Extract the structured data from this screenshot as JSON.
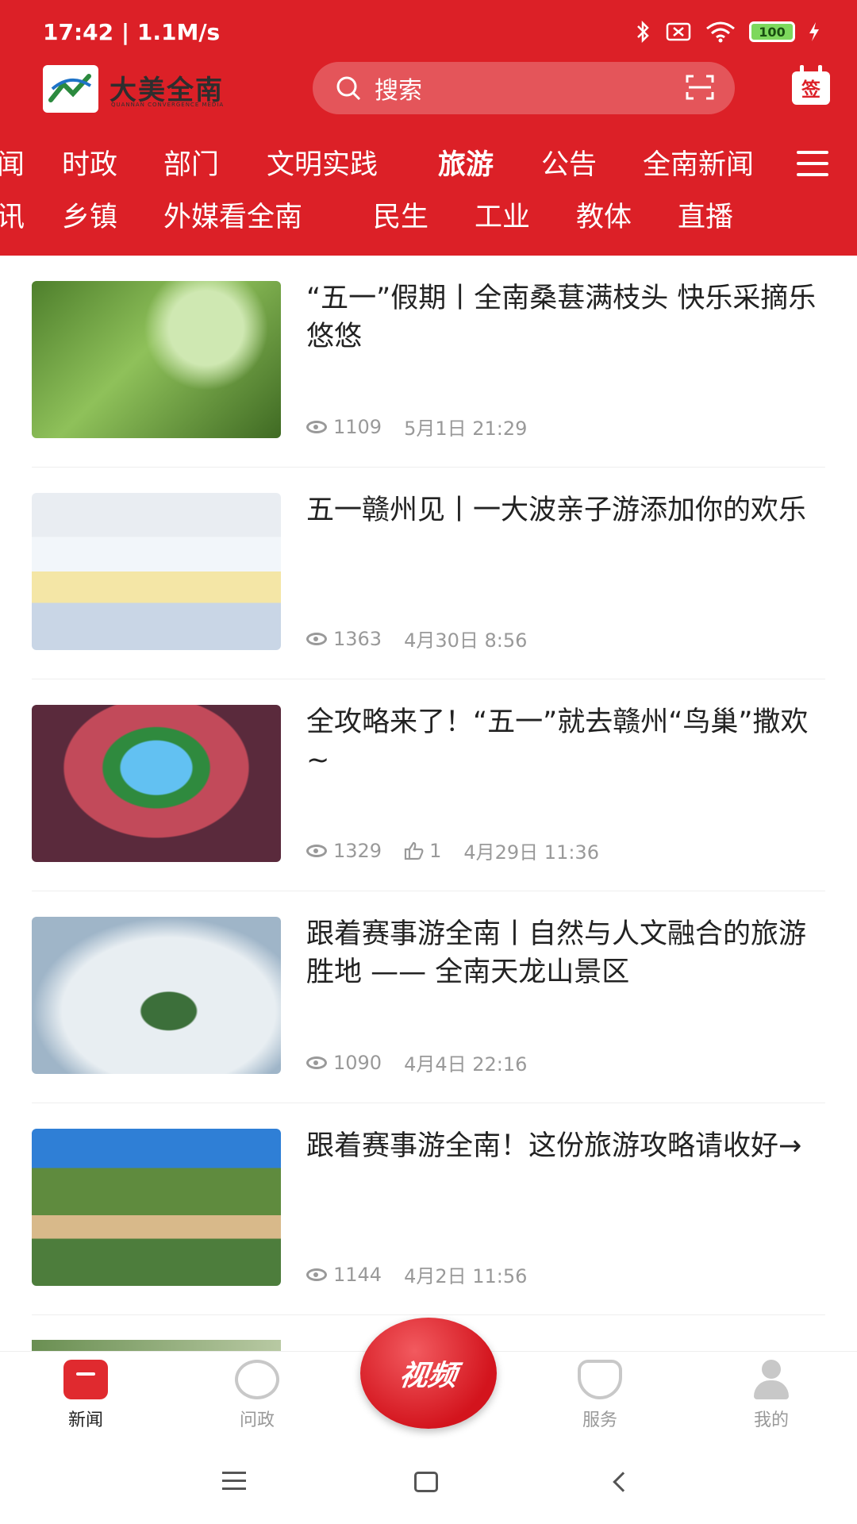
{
  "status_bar": {
    "time_speed": "17:42 | 1.1M/s",
    "battery": "100",
    "icons": [
      "bluetooth-icon",
      "sim-off-icon",
      "wifi-icon",
      "battery-icon",
      "charging-icon"
    ]
  },
  "app": {
    "logo_title": "大美全南",
    "logo_subtitle": "QUANNAN CONVERGENCE MEDIA",
    "search_placeholder": "搜索",
    "sign_label": "签"
  },
  "channels": {
    "row1": [
      "闻",
      "时政",
      "部门",
      "文明实践",
      "旅游",
      "公告",
      "全南新闻"
    ],
    "row2": [
      "讯",
      "乡镇",
      "外媒看全南",
      "民生",
      "工业",
      "教体",
      "直播"
    ],
    "active": "旅游"
  },
  "news": [
    {
      "title": "“五一”假期丨全南桑葚满枝头 快乐采摘乐悠悠",
      "views": "1109",
      "likes": "",
      "date": "5月1日 21:29"
    },
    {
      "title": "五一赣州见丨一大波亲子游添加你的欢乐",
      "views": "1363",
      "likes": "",
      "date": "4月30日 8:56"
    },
    {
      "title": "全攻略来了！“五一”就去赣州“鸟巢”撒欢~",
      "views": "1329",
      "likes": "1",
      "date": "4月29日 11:36"
    },
    {
      "title": "跟着赛事游全南丨自然与人文融合的旅游胜地 —— 全南天龙山景区",
      "views": "1090",
      "likes": "",
      "date": "4月4日 22:16"
    },
    {
      "title": "跟着赛事游全南！这份旅游攻略请收好→",
      "views": "1144",
      "likes": "",
      "date": "4月2日 11:56"
    }
  ],
  "tabbar": {
    "news": "新闻",
    "ask": "问政",
    "video": "视频",
    "service": "服务",
    "mine": "我的"
  },
  "colors": {
    "brand_red": "#dc2027",
    "meta_gray": "#999999"
  }
}
